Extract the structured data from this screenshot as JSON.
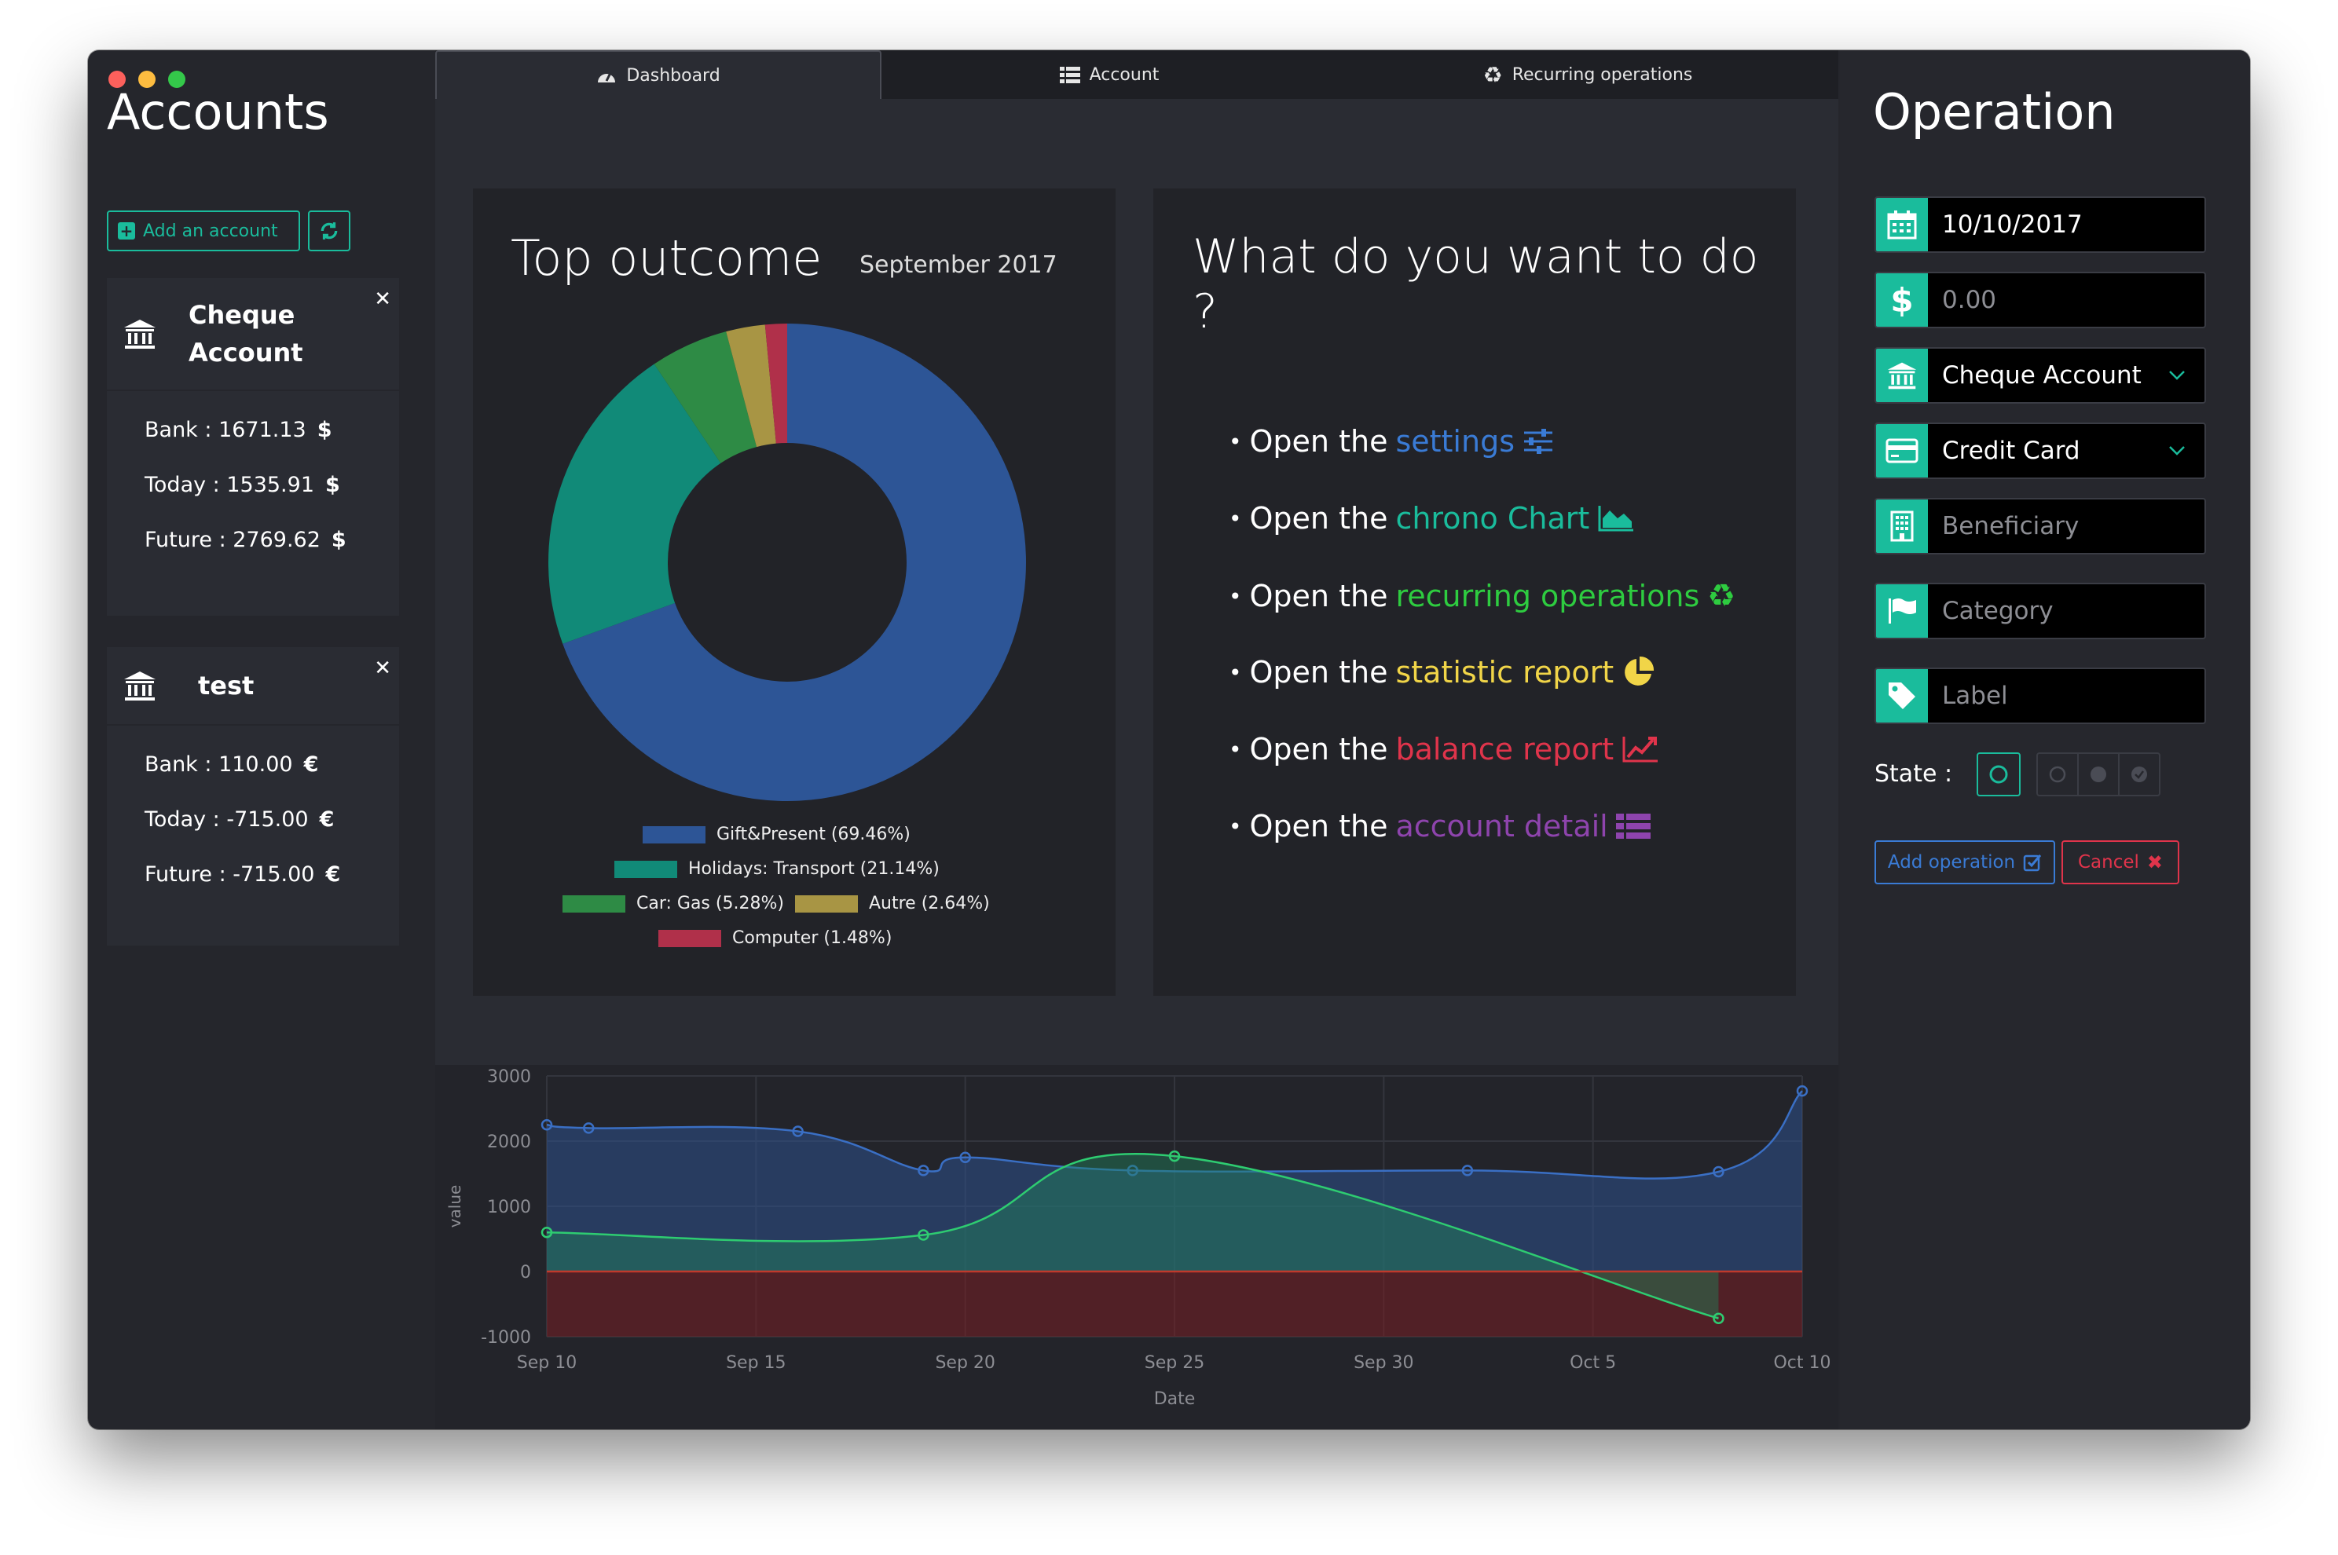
{
  "window": {
    "controls": [
      "close",
      "minimize",
      "maximize"
    ]
  },
  "accounts": {
    "title": "Accounts",
    "add_label": "Add an account",
    "list": [
      {
        "name": "Cheque Account",
        "name_line1": "Cheque",
        "name_line2": "Account",
        "bank": "Bank : 1671.13",
        "today": "Today : 1535.91",
        "future": "Future : 2769.62",
        "currency": "$"
      },
      {
        "name": "test",
        "bank": "Bank : 110.00",
        "today": "Today : -715.00",
        "future": "Future : -715.00",
        "currency": "€"
      }
    ]
  },
  "tabs": [
    {
      "label": "Dashboard",
      "icon": "dashboard-icon",
      "active": true
    },
    {
      "label": "Account",
      "icon": "list-icon",
      "active": false
    },
    {
      "label": "Recurring operations",
      "icon": "recycle-icon",
      "active": false
    }
  ],
  "top_outcome": {
    "title": "Top outcome",
    "month": "September 2017"
  },
  "todo": {
    "title": "What do you want to do ?",
    "prefix": "Open the",
    "items": [
      {
        "link": "settings",
        "color": "#3a7bd5",
        "icon": "sliders-icon"
      },
      {
        "link": "chrono Chart",
        "color": "#1abc9c",
        "icon": "area-chart-icon"
      },
      {
        "link": "recurring operations",
        "color": "#2ecc40",
        "icon": "recycle-icon"
      },
      {
        "link": "statistic report",
        "color": "#f1d548",
        "icon": "pie-chart-icon"
      },
      {
        "link": "balance report",
        "color": "#e0344b",
        "icon": "line-chart-icon"
      },
      {
        "link": "account detail",
        "color": "#8e44ad",
        "icon": "list-icon"
      }
    ]
  },
  "operation": {
    "title": "Operation",
    "date": "10/10/2017",
    "amount_placeholder": "0.00",
    "account": "Cheque Account",
    "payment": "Credit Card",
    "beneficiary_placeholder": "Beneficiary",
    "category_placeholder": "Category",
    "label_placeholder": "Label",
    "state_label": "State :",
    "add_label": "Add operation",
    "cancel_label": "Cancel"
  },
  "chart_data": [
    {
      "type": "pie",
      "labels": [
        "Gift&Present (69.46%)",
        "Holidays: Transport (21.14%)",
        "Car: Gas (5.28%)",
        "Autre (2.64%)",
        "Computer (1.48%)"
      ],
      "values": [
        69.46,
        21.14,
        5.28,
        2.64,
        1.48
      ],
      "colors": [
        "#2d5596",
        "#118a78",
        "#2e8b45",
        "#a89544",
        "#b0304a"
      ],
      "donut": true
    },
    {
      "type": "line",
      "xlabel": "Date",
      "ylabel": "value",
      "ylim": [
        -1000,
        3000
      ],
      "yticks": [
        "3000",
        "2000",
        "1000",
        "0",
        "-1000"
      ],
      "xticks": [
        "Sep 10",
        "Sep 15",
        "Sep 20",
        "Sep 25",
        "Sep 30",
        "Oct 5",
        "Oct 10"
      ],
      "grid": true,
      "filled": true,
      "series": [
        {
          "color": "#3a6fc4",
          "points": [
            {
              "x": "2017-09-10",
              "y": 2250
            },
            {
              "x": "2017-09-11",
              "y": 2200
            },
            {
              "x": "2017-09-16",
              "y": 2150
            },
            {
              "x": "2017-09-19",
              "y": 1550
            },
            {
              "x": "2017-09-20",
              "y": 1750
            },
            {
              "x": "2017-09-24",
              "y": 1550
            },
            {
              "x": "2017-10-02",
              "y": 1550
            },
            {
              "x": "2017-10-08",
              "y": 1530
            },
            {
              "x": "2017-10-10",
              "y": 2770
            }
          ]
        },
        {
          "color": "#2ecc71",
          "points": [
            {
              "x": "2017-09-10",
              "y": 600
            },
            {
              "x": "2017-09-19",
              "y": 560
            },
            {
              "x": "2017-09-25",
              "y": 1770
            },
            {
              "x": "2017-10-08",
              "y": -720
            }
          ]
        },
        {
          "color": "#c0392b",
          "points": [
            {
              "x": "2017-09-10",
              "y": 0
            },
            {
              "x": "2017-10-10",
              "y": 0
            }
          ]
        }
      ]
    }
  ]
}
